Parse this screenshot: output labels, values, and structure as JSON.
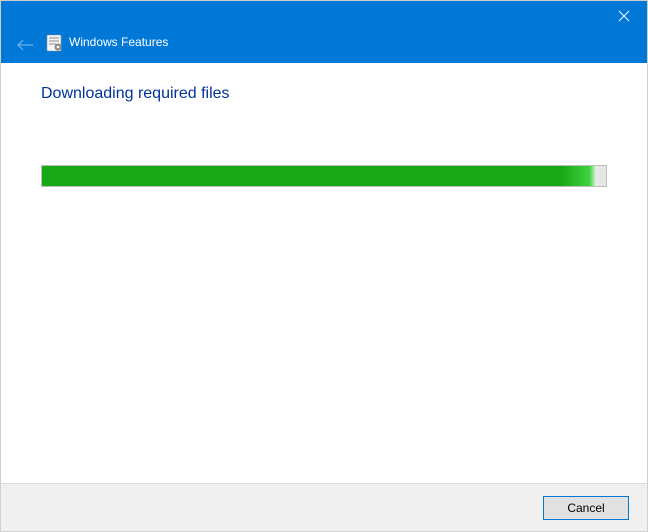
{
  "titlebar": {
    "title": "Windows Features",
    "close_label": "Close",
    "back_label": "Back"
  },
  "content": {
    "heading": "Downloading required files",
    "progress_percent": 98
  },
  "footer": {
    "cancel_label": "Cancel"
  },
  "colors": {
    "accent": "#0078d7",
    "progress": "#18a818",
    "heading": "#003399"
  }
}
